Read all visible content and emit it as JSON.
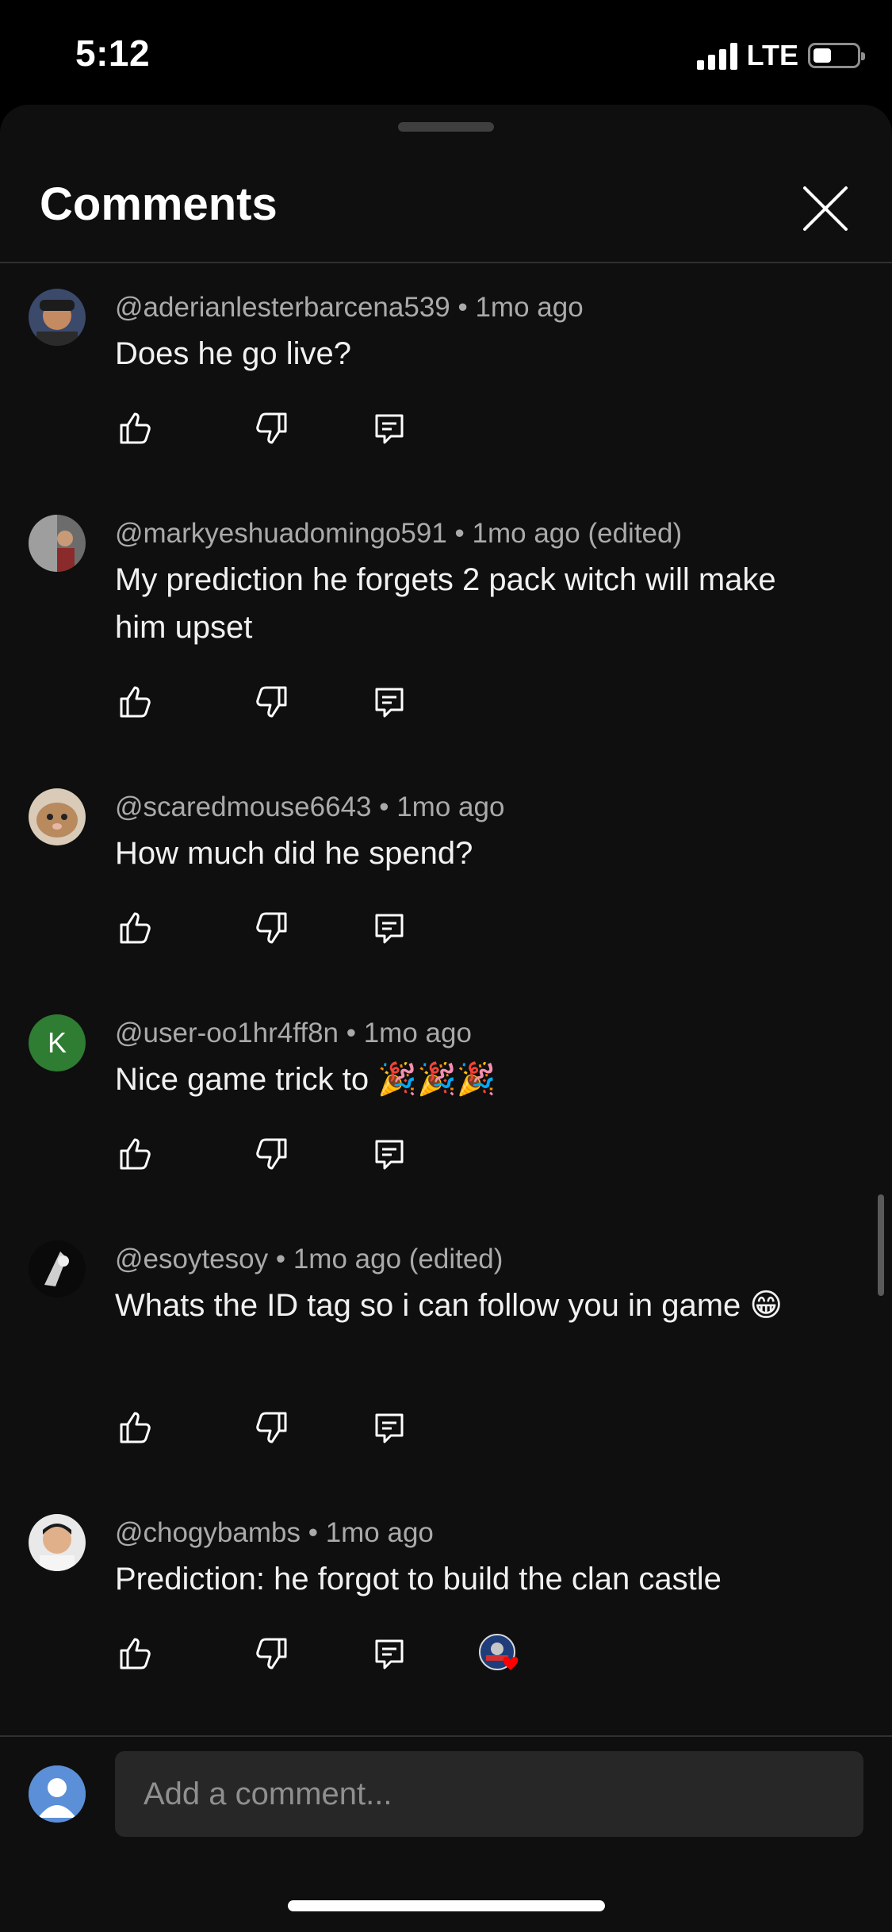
{
  "status_bar": {
    "time": "5:12",
    "network": "LTE",
    "battery_level": 0.3
  },
  "header": {
    "title": "Comments",
    "close_icon": "close-icon"
  },
  "comments": [
    {
      "author": "@aderianlesterbarcena539",
      "time": "1mo ago",
      "text": "Does he go live?"
    },
    {
      "author": "@markyeshuadomingo591",
      "time": "1mo ago (edited)",
      "text": "My prediction he forgets 2 pack witch will make him upset"
    },
    {
      "author": "@scaredmouse6643",
      "time": "1mo ago",
      "text": "How much did he spend?"
    },
    {
      "author": "@user-oo1hr4ff8n",
      "time": "1mo ago",
      "text": "Nice game trick to 🎉🎉🎉",
      "avatar_letter": "K",
      "avatar_color": "#2e7d32"
    },
    {
      "author": "@esoytesoy",
      "time": "1mo ago (edited)",
      "text": "Whats the ID tag so i can follow you in game 😁"
    },
    {
      "author": "@chogybambs",
      "time": "1mo ago",
      "text": "Prediction: he forgot to build the clan castle",
      "creator_heart": true
    }
  ],
  "input": {
    "placeholder": "Add a comment..."
  },
  "colors": {
    "background": "#0f0f0f",
    "meta_text": "#aaaaaa",
    "input_bg": "#272727",
    "heart": "#ff0000"
  }
}
